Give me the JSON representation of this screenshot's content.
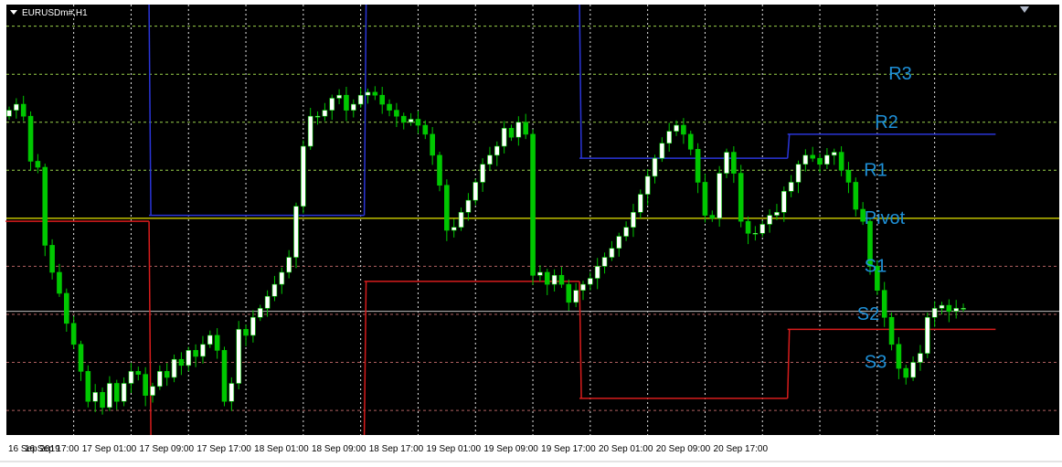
{
  "window": {
    "symbol_label": "EURUSDm#,H1"
  },
  "colors": {
    "background": "#000000",
    "grid": "#ffffff",
    "bull_candle": "#ffffff",
    "bear_candle": "#00c800",
    "pivot_line": "#e6e600",
    "resistance_grid": "#9ad24a",
    "support_grid": "#b06060",
    "upper_band": "#2a35d8",
    "lower_band": "#d81c1c",
    "level_label": "#1e90d8"
  },
  "chart_data": {
    "type": "candlestick",
    "x_tick_labels": [
      "16 Sep 2019",
      "16 Sep 17:00",
      "17 Sep 01:00",
      "17 Sep 09:00",
      "17 Sep 17:00",
      "18 Sep 01:00",
      "18 Sep 09:00",
      "18 Sep 17:00",
      "19 Sep 01:00",
      "19 Sep 09:00",
      "19 Sep 17:00",
      "20 Sep 01:00",
      "20 Sep 09:00",
      "20 Sep 17:00"
    ],
    "level_labels": [
      "R3",
      "R2",
      "R1",
      "Pivot",
      "S1",
      "S2",
      "S3"
    ],
    "levels": {
      "R3": 1.1072,
      "R2": 1.1056,
      "R1": 1.104,
      "Pivot": 1.1024,
      "S1": 1.1008,
      "S2": 1.0992,
      "S3": 1.0976
    },
    "extra_grid_levels": [
      1.1088,
      1.096
    ],
    "ylim": [
      1.09518,
      1.10952
    ],
    "current_price_line": 1.0993,
    "upper_band": [
      {
        "x0": 0,
        "x1": 19,
        "y": null
      },
      {
        "x0": 20,
        "x1": 49,
        "y": 1.1025
      },
      {
        "x0": 50,
        "x1": 79,
        "y": null
      },
      {
        "x0": 80,
        "x1": 108,
        "y": 1.1044
      },
      {
        "x0": 109,
        "x1": 137,
        "y": 1.1052
      }
    ],
    "lower_band": [
      {
        "x0": 0,
        "x1": 19,
        "y": 1.1023
      },
      {
        "x0": 20,
        "x1": 49,
        "y": null
      },
      {
        "x0": 50,
        "x1": 79,
        "y": 1.1003
      },
      {
        "x0": 80,
        "x1": 108,
        "y": 1.0964
      },
      {
        "x0": 109,
        "x1": 137,
        "y": 1.0987
      }
    ],
    "candles_close": [
      1.106,
      1.1062,
      1.1058,
      1.1043,
      1.1041,
      1.1015,
      1.1006,
      1.0999,
      1.0989,
      1.0982,
      1.0973,
      1.0963,
      1.0966,
      1.0961,
      1.0969,
      1.0963,
      1.0969,
      1.0973,
      1.0972,
      1.0965,
      1.0968,
      1.0973,
      1.0971,
      1.0977,
      1.0975,
      1.098,
      1.0978,
      1.0982,
      1.0985,
      1.098,
      1.0963,
      1.0969,
      1.0987,
      1.0985,
      1.0991,
      1.0994,
      1.0998,
      1.1002,
      1.1006,
      1.1011,
      1.1028,
      1.1048,
      1.1058,
      1.1058,
      1.106,
      1.1064,
      1.1065,
      1.106,
      1.1062,
      1.1065,
      1.1066,
      1.1065,
      1.1062,
      1.106,
      1.1058,
      1.1056,
      1.1057,
      1.1055,
      1.1052,
      1.1045,
      1.1035,
      1.102,
      1.1021,
      1.1026,
      1.103,
      1.1036,
      1.1042,
      1.1045,
      1.1048,
      1.1054,
      1.1051,
      1.1056,
      1.1052,
      1.1005,
      1.1006,
      1.1002,
      1.1005,
      1.1002,
      1.0996,
      1.1,
      1.1002,
      1.1004,
      1.1008,
      1.1011,
      1.1014,
      1.1018,
      1.1021,
      1.1026,
      1.1032,
      1.1038,
      1.1044,
      1.1049,
      1.1053,
      1.1055,
      1.1052,
      1.1047,
      1.1036,
      1.1025,
      1.1024,
      1.1039,
      1.1046,
      1.1039,
      1.1023,
      1.1019,
      1.1019,
      1.1022,
      1.1025,
      1.1026,
      1.1033,
      1.1036,
      1.1042,
      1.1045,
      1.1044,
      1.1042,
      1.1045,
      1.1046,
      1.104,
      1.1036,
      1.1027,
      1.1023,
      1.1008,
      1.1,
      1.0991,
      1.0982,
      1.0974,
      1.0971,
      1.0976,
      1.0979,
      1.0991,
      1.0994,
      1.0995,
      1.0993,
      1.0994,
      1.0994
    ]
  }
}
